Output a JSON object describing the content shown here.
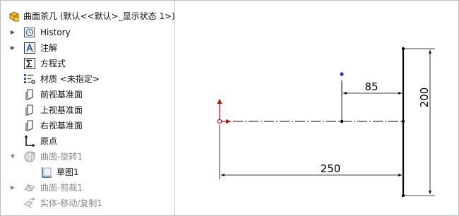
{
  "tree": {
    "root_label": "曲面茶几 (默认<<默认>_显示状态 1>)",
    "items": [
      {
        "label": "History",
        "icon": "history-icon"
      },
      {
        "label": "注解",
        "icon": "annotations-icon"
      },
      {
        "label": "方程式",
        "icon": "equations-icon"
      },
      {
        "label": "材质 <未指定>",
        "icon": "material-icon"
      },
      {
        "label": "前视基准面",
        "icon": "plane-icon"
      },
      {
        "label": "上视基准面",
        "icon": "plane-icon"
      },
      {
        "label": "右视基准面",
        "icon": "plane-icon"
      },
      {
        "label": "原点",
        "icon": "origin-icon"
      },
      {
        "label": "曲面-旋转1",
        "icon": "revolve-surface-icon"
      },
      {
        "label": "草图1",
        "icon": "sketch-icon"
      },
      {
        "label": "曲面-剪裁1",
        "icon": "trim-surface-icon"
      },
      {
        "label": "实体-移动/复制1",
        "icon": "move-copy-body-icon"
      }
    ]
  },
  "sketch": {
    "dim_85": "85",
    "dim_200": "200",
    "dim_250": "250"
  },
  "colors": {
    "origin_red": "#d40000",
    "point_blue": "#1a1aff",
    "line": "#000000"
  }
}
